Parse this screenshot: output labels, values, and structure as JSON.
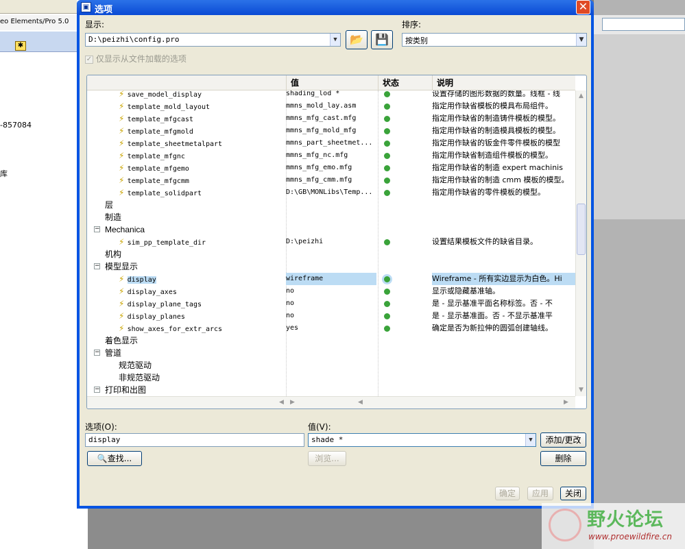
{
  "background": {
    "app_title": "eo Elements/Pro 5.0",
    "tab_icon": "✱",
    "side_text_1": "-857084",
    "side_text_2": "库",
    "watermark_title": "野火论坛",
    "watermark_url": "www.proewildfire.cn"
  },
  "dialog": {
    "title": "选项",
    "close_glyph": "✕",
    "show_label": "显示:",
    "show_value": "D:\\peizhi\\config.pro",
    "sort_label": "排序:",
    "sort_value": "按类别",
    "only_loaded_label": "仅显示从文件加载的选项",
    "columns": {
      "value": "值",
      "status": "状态",
      "description": "说明"
    },
    "rows": [
      {
        "type": "opt",
        "name": "save_model_display",
        "value": "shading_lod *",
        "desc": "设置存储的图形数据的数量。线框 - 线"
      },
      {
        "type": "opt",
        "name": "template_mold_layout",
        "value": "mmns_mold_lay.asm",
        "desc": "指定用作缺省模板的模具布局组件。"
      },
      {
        "type": "opt",
        "name": "template_mfgcast",
        "value": "mmns_mfg_cast.mfg",
        "desc": "指定用作缺省的制造铸件模板的模型。"
      },
      {
        "type": "opt",
        "name": "template_mfgmold",
        "value": "mmns_mfg_mold_mfg",
        "desc": "指定用作缺省的制造模具模板的模型。"
      },
      {
        "type": "opt",
        "name": "template_sheetmetalpart",
        "value": "mmns_part_sheetmet...",
        "desc": "指定用作缺省的钣金件零件模板的模型"
      },
      {
        "type": "opt",
        "name": "template_mfgnc",
        "value": "mmns_mfg_nc.mfg",
        "desc": "指定用作缺省制造组件模板的模型。"
      },
      {
        "type": "opt",
        "name": "template_mfgemo",
        "value": "mmns_mfg_emo.mfg",
        "desc": "指定用作缺省的制造 expert machinis"
      },
      {
        "type": "opt",
        "name": "template_mfgcmm",
        "value": "mmns_mfg_cmm.mfg",
        "desc": "指定用作缺省的制造 cmm 模板的模型。"
      },
      {
        "type": "opt",
        "name": "template_solidpart",
        "value": "D:\\GB\\MONLibs\\Temp...",
        "desc": "指定用作缺省的零件模板的模型。"
      },
      {
        "type": "cat",
        "name": "层"
      },
      {
        "type": "cat",
        "name": "制造"
      },
      {
        "type": "cat",
        "name": "Mechanica",
        "expanded": true
      },
      {
        "type": "opt",
        "name": "sim_pp_template_dir",
        "value": "D:\\peizhi",
        "desc": "设置结果模板文件的缺省目录。"
      },
      {
        "type": "cat",
        "name": "机构"
      },
      {
        "type": "cat",
        "name": "模型显示",
        "expanded": true
      },
      {
        "type": "opt",
        "name": "display",
        "value": "wireframe",
        "desc": "Wireframe - 所有实边显示为白色。Hi",
        "selected": true
      },
      {
        "type": "opt",
        "name": "display_axes",
        "value": "no",
        "desc": "显示或隐藏基准轴。"
      },
      {
        "type": "opt",
        "name": "display_plane_tags",
        "value": "no",
        "desc": "是 - 显示基准平面名称标签。否 - 不"
      },
      {
        "type": "opt",
        "name": "display_planes",
        "value": "no",
        "desc": "是 - 显示基准面。否 - 不显示基准平"
      },
      {
        "type": "opt",
        "name": "show_axes_for_extr_arcs",
        "value": "yes",
        "desc": "确定是否为新拉伸的圆弧创建轴线。"
      },
      {
        "type": "cat",
        "name": "着色显示"
      },
      {
        "type": "cat",
        "name": "管道",
        "expanded": true
      },
      {
        "type": "sub",
        "name": "规范驱动"
      },
      {
        "type": "sub",
        "name": "非规范驱动"
      },
      {
        "type": "cat",
        "name": "打印和出图",
        "expanded": true
      }
    ],
    "option_label": "选项(O):",
    "option_value": "display",
    "value_label": "值(V):",
    "value_value": "shade *",
    "add_change_button": "添加/更改",
    "find_button": "查找...",
    "browse_button": "浏览...",
    "delete_button": "删除",
    "ok_button": "确定",
    "apply_button": "应用",
    "close_button": "关闭"
  }
}
